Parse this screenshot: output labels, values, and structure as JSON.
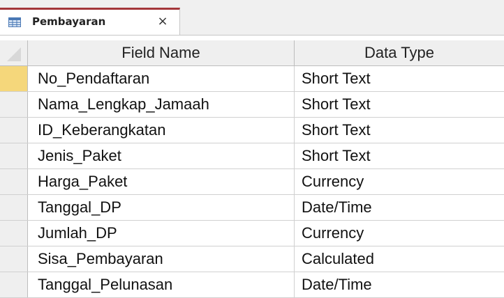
{
  "tab": {
    "label": "Pembayaran",
    "close_glyph": "×",
    "icon": "table-icon",
    "accent_color": "#a4373a"
  },
  "grid": {
    "columns": [
      "Field Name",
      "Data Type"
    ],
    "current_row_color": "#f5d77b",
    "rows": [
      {
        "field": "No_Pendaftaran",
        "type": "Short Text"
      },
      {
        "field": "Nama_Lengkap_Jamaah",
        "type": "Short Text"
      },
      {
        "field": "ID_Keberangkatan",
        "type": "Short Text"
      },
      {
        "field": "Jenis_Paket",
        "type": "Short Text"
      },
      {
        "field": "Harga_Paket",
        "type": "Currency"
      },
      {
        "field": "Tanggal_DP",
        "type": "Date/Time"
      },
      {
        "field": "Jumlah_DP",
        "type": "Currency"
      },
      {
        "field": "Sisa_Pembayaran",
        "type": "Calculated"
      },
      {
        "field": "Tanggal_Pelunasan",
        "type": "Date/Time"
      }
    ]
  }
}
